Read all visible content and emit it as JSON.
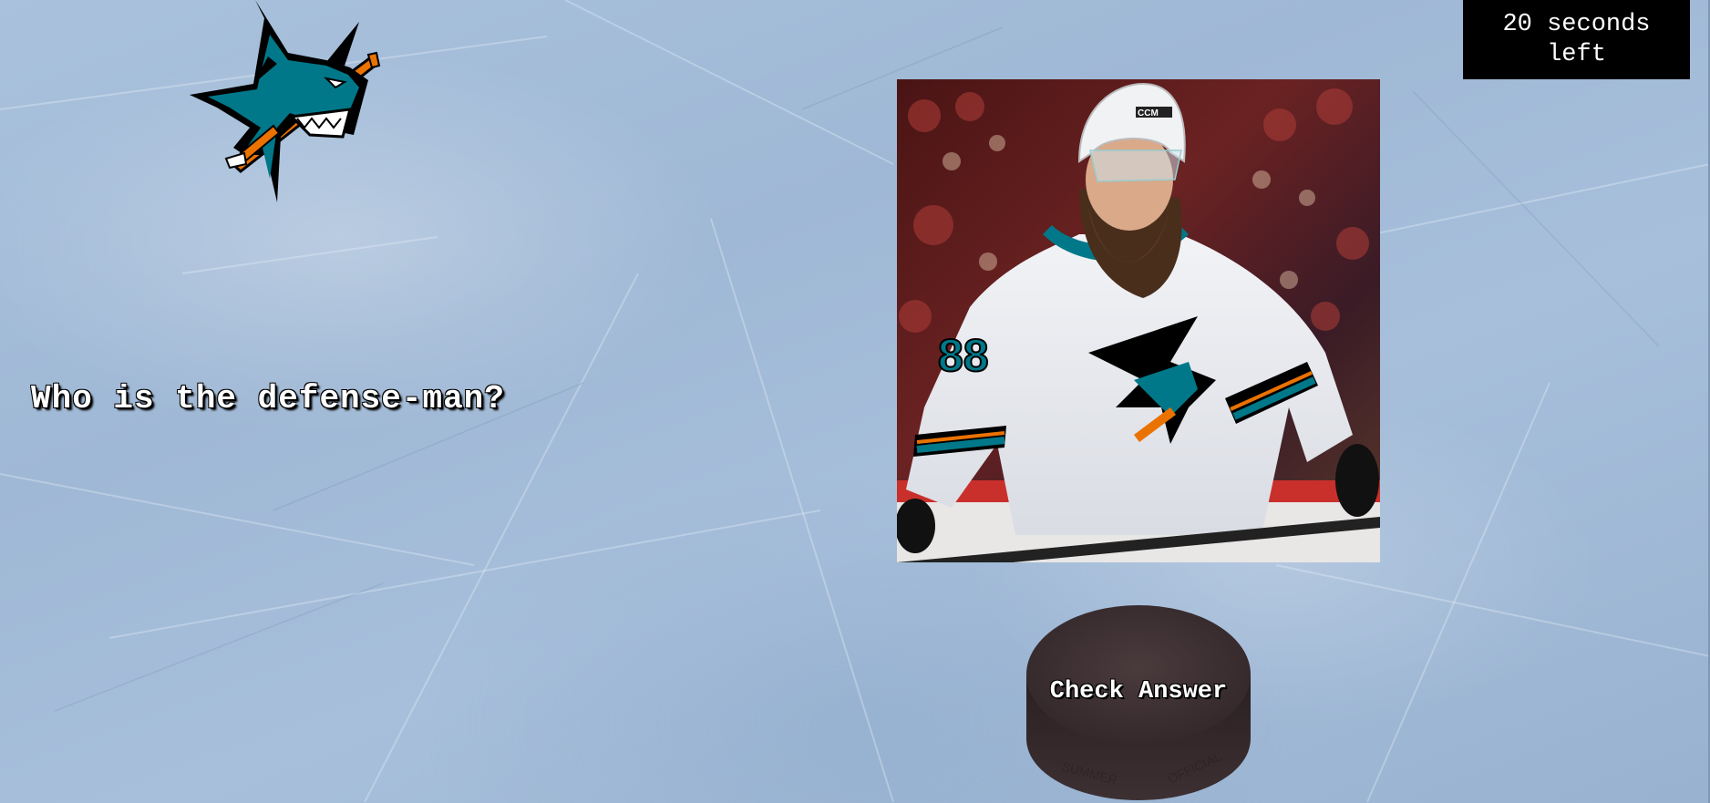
{
  "timer": {
    "text": "20 seconds left"
  },
  "question": {
    "text": "Who is the defense-man?"
  },
  "answer_button": {
    "label": "Check Answer"
  },
  "logo": {
    "icon": "shark-logo-icon"
  },
  "player_photo": {
    "icon": "hockey-player-photo",
    "jersey_number": "88",
    "helmet_brand": "CCM"
  },
  "colors": {
    "teal": "#007889",
    "orange": "#ea7200",
    "black": "#000000",
    "puck": "#3a2d2f",
    "ice": "#a7bfdb"
  }
}
